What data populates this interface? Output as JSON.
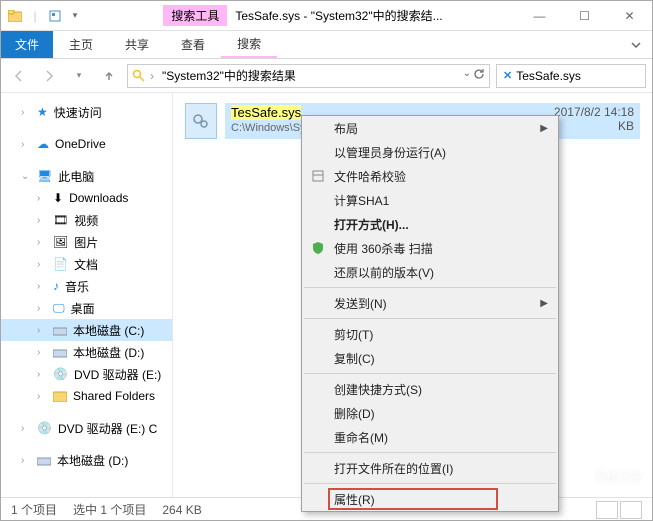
{
  "window": {
    "tool_badge": "搜索工具",
    "title": "TesSafe.sys - \"System32\"中的搜索结...",
    "min": "—",
    "max": "☐",
    "close": "✕"
  },
  "ribbon": {
    "file": "文件",
    "tabs": [
      "主页",
      "共享",
      "查看",
      "搜索"
    ]
  },
  "address": {
    "crumb": "\"System32\"中的搜索结果",
    "search_value": "TesSafe.sys"
  },
  "sidebar": {
    "quick": "快速访问",
    "onedrive": "OneDrive",
    "pc": "此电脑",
    "downloads": "Downloads",
    "video": "视频",
    "pictures": "图片",
    "documents": "文档",
    "music": "音乐",
    "desktop": "桌面",
    "driveC": "本地磁盘 (C:)",
    "driveD": "本地磁盘 (D:)",
    "dvdE": "DVD 驱动器 (E:)",
    "shared": "Shared Folders",
    "dvdE2": "DVD 驱动器 (E:) C",
    "driveD2": "本地磁盘 (D:)"
  },
  "file": {
    "name": "TesSafe.sys",
    "path": "C:\\Windows\\Sy",
    "date": "2017/8/2 14:18",
    "size": "KB"
  },
  "context": {
    "items": [
      {
        "label": "布局",
        "submenu": true
      },
      {
        "label": "以管理员身份运行(A)"
      },
      {
        "label": "文件哈希校验",
        "icon": "hash"
      },
      {
        "label": "计算SHA1"
      },
      {
        "label": "打开方式(H)...",
        "bold": true
      },
      {
        "label": "使用 360杀毒 扫描",
        "icon": "shield"
      },
      {
        "label": "还原以前的版本(V)"
      },
      {
        "sep": true
      },
      {
        "label": "发送到(N)",
        "submenu": true
      },
      {
        "sep": true
      },
      {
        "label": "剪切(T)"
      },
      {
        "label": "复制(C)"
      },
      {
        "sep": true
      },
      {
        "label": "创建快捷方式(S)"
      },
      {
        "label": "删除(D)"
      },
      {
        "label": "重命名(M)"
      },
      {
        "sep": true
      },
      {
        "label": "打开文件所在的位置(I)"
      },
      {
        "sep": true
      },
      {
        "label": "属性(R)",
        "boxed": true
      }
    ]
  },
  "status": {
    "count": "1 个项目",
    "selected": "选中 1 个项目",
    "size": "264 KB"
  },
  "watermark": "系统之家"
}
